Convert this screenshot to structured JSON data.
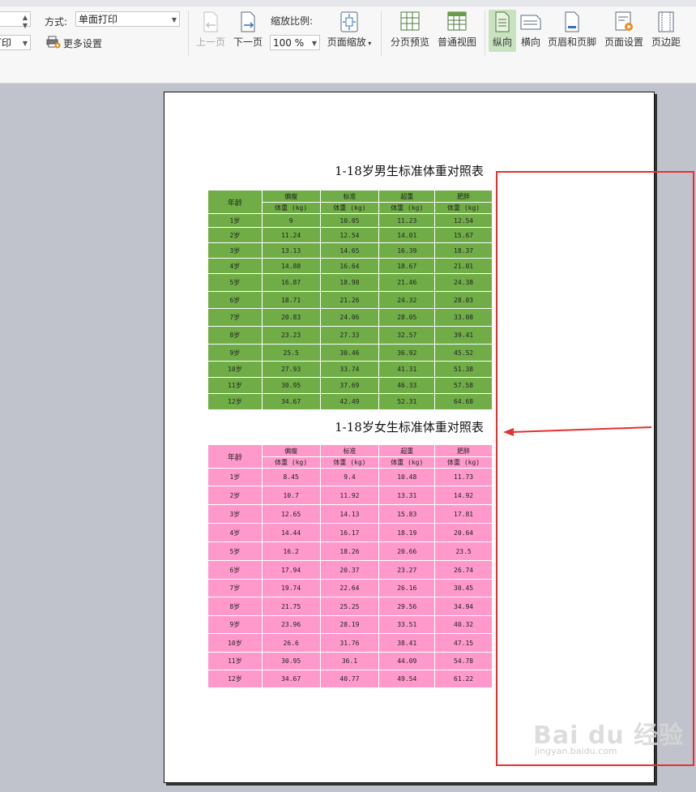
{
  "toolbar": {
    "cut_field": "打印",
    "mode_label": "方式:",
    "mode_value": "单面打印",
    "more_settings": "更多设置",
    "prev_page": "上一页",
    "next_page": "下一页",
    "zoom_label": "缩放比例:",
    "zoom_value": "100 %",
    "page_zoom": "页面缩放",
    "page_break_preview": "分页预览",
    "normal_view": "普通视图",
    "portrait": "纵向",
    "landscape": "横向",
    "header_footer": "页眉和页脚",
    "page_setup": "页面设置",
    "margins": "页边距"
  },
  "boys": {
    "title": "1-18岁男生标准体重对照表",
    "age_header": "年龄",
    "categories": [
      "偏瘦",
      "标准",
      "超重",
      "肥胖"
    ],
    "unit": "体重 (kg)",
    "rows": [
      [
        "1岁",
        "9",
        "10.05",
        "11.23",
        "12.54"
      ],
      [
        "2岁",
        "11.24",
        "12.54",
        "14.01",
        "15.67"
      ],
      [
        "3岁",
        "13.13",
        "14.65",
        "16.39",
        "18.37"
      ],
      [
        "4岁",
        "14.88",
        "16.64",
        "18.67",
        "21.01"
      ],
      [
        "5岁",
        "16.87",
        "18.98",
        "21.46",
        "24.38"
      ],
      [
        "6岁",
        "18.71",
        "21.26",
        "24.32",
        "28.03"
      ],
      [
        "7岁",
        "20.83",
        "24.06",
        "28.05",
        "33.08"
      ],
      [
        "8岁",
        "23.23",
        "27.33",
        "32.57",
        "39.41"
      ],
      [
        "9岁",
        "25.5",
        "30.46",
        "36.92",
        "45.52"
      ],
      [
        "10岁",
        "27.93",
        "33.74",
        "41.31",
        "51.38"
      ],
      [
        "11岁",
        "30.95",
        "37.69",
        "46.33",
        "57.58"
      ],
      [
        "12岁",
        "34.67",
        "42.49",
        "52.31",
        "64.68"
      ]
    ]
  },
  "girls": {
    "title": "1-18岁女生标准体重对照表",
    "age_header": "年龄",
    "categories": [
      "偏瘦",
      "标准",
      "超重",
      "肥胖"
    ],
    "unit": "体重 (kg)",
    "rows": [
      [
        "1岁",
        "8.45",
        "9.4",
        "10.48",
        "11.73"
      ],
      [
        "2岁",
        "10.7",
        "11.92",
        "13.31",
        "14.92"
      ],
      [
        "3岁",
        "12.65",
        "14.13",
        "15.83",
        "17.81"
      ],
      [
        "4岁",
        "14.44",
        "16.17",
        "18.19",
        "20.64"
      ],
      [
        "5岁",
        "16.2",
        "18.26",
        "20.66",
        "23.5"
      ],
      [
        "6岁",
        "17.94",
        "20.37",
        "23.27",
        "26.74"
      ],
      [
        "7岁",
        "19.74",
        "22.64",
        "26.16",
        "30.45"
      ],
      [
        "8岁",
        "21.75",
        "25.25",
        "29.56",
        "34.94"
      ],
      [
        "9岁",
        "23.96",
        "28.19",
        "33.51",
        "40.32"
      ],
      [
        "10岁",
        "26.6",
        "31.76",
        "38.41",
        "47.15"
      ],
      [
        "11岁",
        "30.95",
        "36.1",
        "44.09",
        "54.78"
      ],
      [
        "12岁",
        "34.67",
        "40.77",
        "49.54",
        "61.22"
      ]
    ]
  },
  "watermark": {
    "brand": "Bai du 经验",
    "url": "jingyan.baidu.com"
  },
  "colors": {
    "boys_fill": "#70ad47",
    "girls_fill": "#ff99cc",
    "annotation": "#e53030",
    "active_button": "#c9e2c0"
  }
}
